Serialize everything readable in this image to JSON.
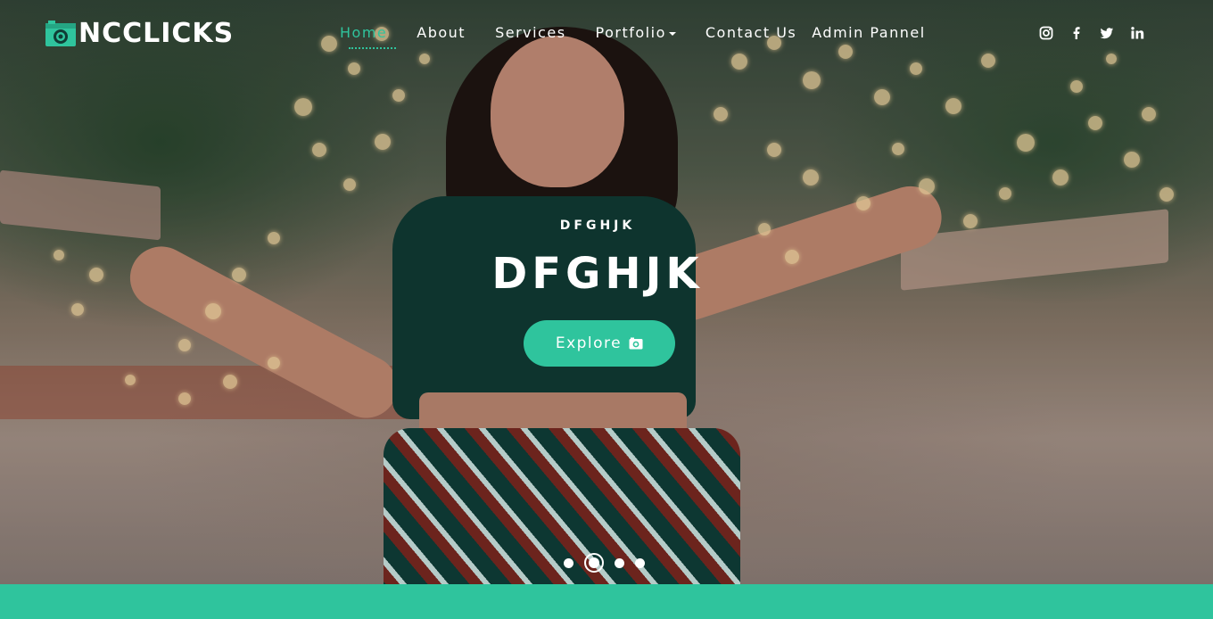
{
  "brand": {
    "name": "NCCLICKS",
    "accent": "#2fc49d"
  },
  "nav": {
    "items": [
      {
        "label": "Home",
        "active": true
      },
      {
        "label": "About"
      },
      {
        "label": "Services"
      },
      {
        "label": "Portfolio",
        "dropdown": true
      },
      {
        "label": "Contact Us"
      },
      {
        "label": "Admin Pannel"
      }
    ]
  },
  "social": [
    "instagram-icon",
    "facebook-icon",
    "twitter-icon",
    "linkedin-icon"
  ],
  "hero": {
    "eyebrow": "DFGHJK",
    "headline": "DFGHJK",
    "cta_label": "Explore",
    "cta_icon": "camera-icon"
  },
  "carousel": {
    "slides": 4,
    "active_index": 1
  }
}
